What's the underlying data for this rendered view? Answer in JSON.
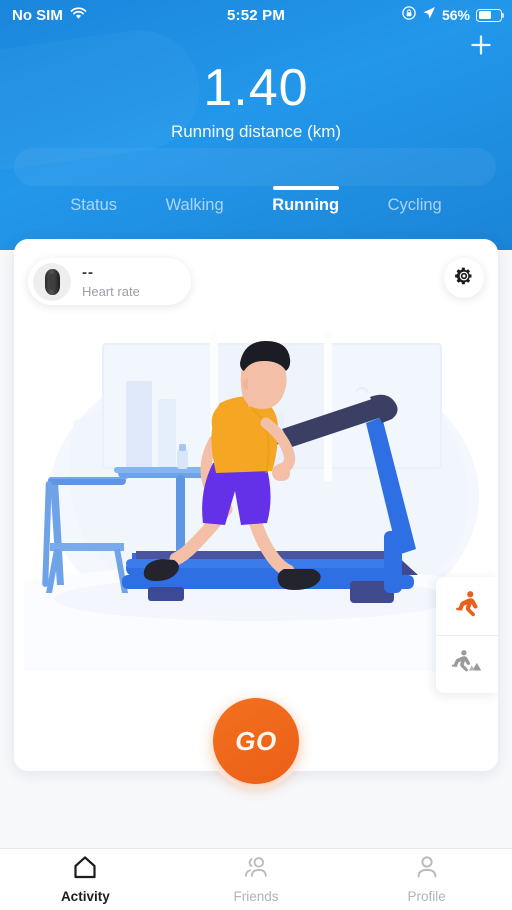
{
  "status_bar": {
    "carrier": "No SIM",
    "wifi_icon": "wifi-icon",
    "time": "5:52 PM",
    "rotation_lock_icon": "rotation-lock-icon",
    "location_icon": "location-arrow-icon",
    "battery_percent": "56%",
    "battery_level": 56
  },
  "header": {
    "add_icon": "plus-icon",
    "stat_value": "1.40",
    "stat_label": "Running distance (km)",
    "accent_blue": "#1f91e6"
  },
  "tabs": [
    {
      "label": "Status",
      "active": false
    },
    {
      "label": "Walking",
      "active": false
    },
    {
      "label": "Running",
      "active": true
    },
    {
      "label": "Cycling",
      "active": false
    }
  ],
  "card": {
    "heart_rate": {
      "device_icon": "fitness-band-icon",
      "value": "--",
      "label": "Heart rate"
    },
    "settings_icon": "gear-icon",
    "illustration": {
      "name": "person-running-on-treadmill-illustration",
      "shirt_color": "#f5a623",
      "shorts_color": "#6430e8",
      "treadmill_color": "#2f6fe4",
      "skin_color": "#f3bfa6"
    },
    "mode_switch": [
      {
        "icon": "indoor-running-icon",
        "label": "Indoor run",
        "active": true,
        "color": "#e8601c"
      },
      {
        "icon": "outdoor-running-icon",
        "label": "Outdoor run",
        "active": false,
        "color": "#9a9a9a"
      }
    ],
    "go_button": {
      "label": "GO",
      "color": "#ef6a1e"
    }
  },
  "bottom_nav": [
    {
      "label": "Activity",
      "icon": "home-icon",
      "active": true
    },
    {
      "label": "Friends",
      "icon": "people-icon",
      "active": false
    },
    {
      "label": "Profile",
      "icon": "person-icon",
      "active": false
    }
  ]
}
